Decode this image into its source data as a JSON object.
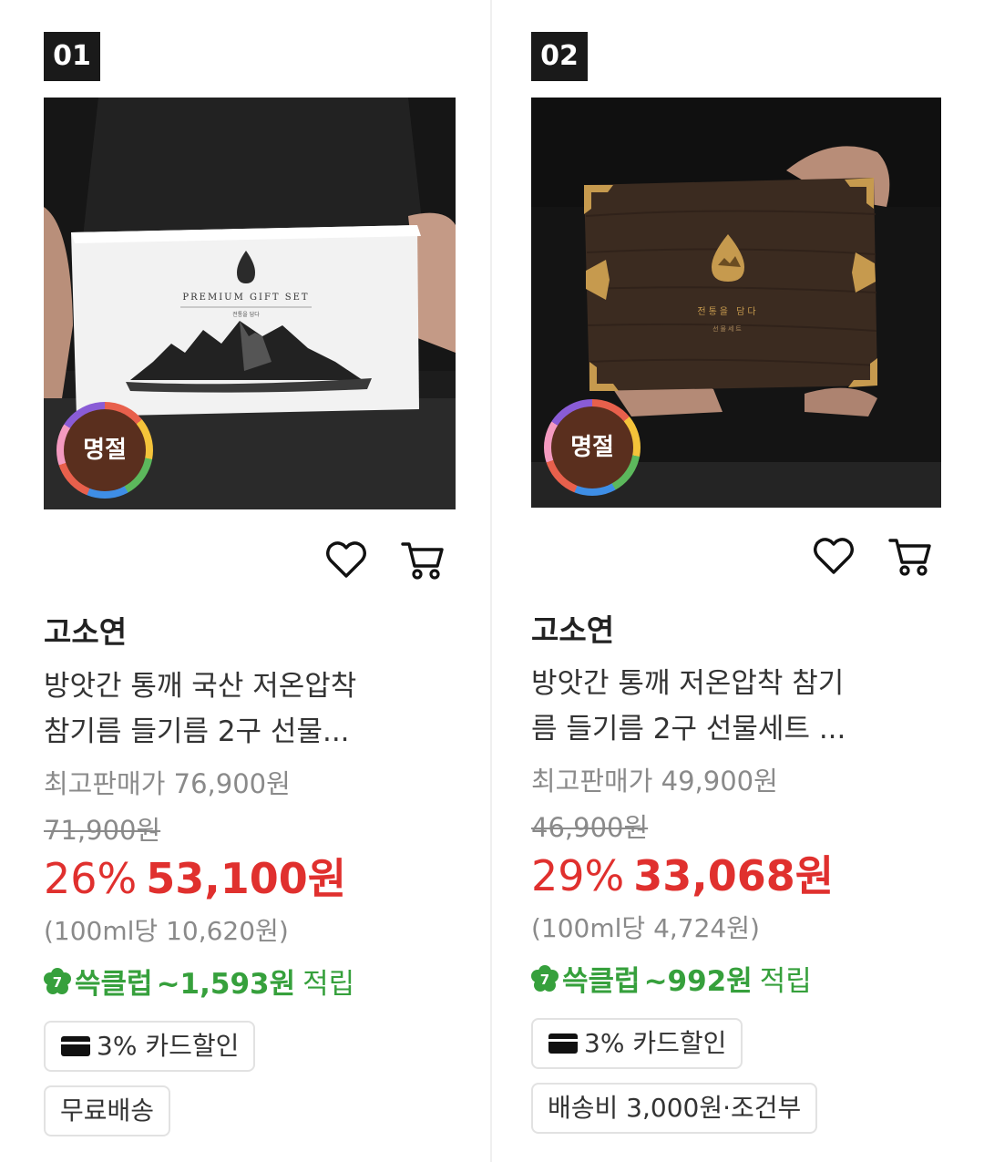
{
  "products": [
    {
      "rank": "01",
      "badge": "명절",
      "brand": "고소연",
      "title_lines": [
        "방앗간 통깨 국산 저온압착",
        "참기름 들기름 2구 선물..."
      ],
      "max_price": "최고판매가 76,900원",
      "original_price": "71,900원",
      "discount_rate": "26%",
      "sale_price": "53,100원",
      "unit_price": "(100ml당 10,620원)",
      "club_name": "쓱클럽",
      "club_amount": "~1,593원",
      "club_word": "적립",
      "card_discount": "3% 카드할인",
      "shipping": "무료배송",
      "box_text": "PREMIUM GIFT SET",
      "box_sub": "전통을 담다"
    },
    {
      "rank": "02",
      "badge": "명절",
      "brand": "고소연",
      "title_lines": [
        "방앗간 통깨 저온압착 참기",
        "름 들기름 2구 선물세트 ..."
      ],
      "max_price": "최고판매가 49,900원",
      "original_price": "46,900원",
      "discount_rate": "29%",
      "sale_price": "33,068원",
      "unit_price": "(100ml당 4,724원)",
      "club_name": "쓱클럽",
      "club_amount": "~992원",
      "club_word": "적립",
      "card_discount": "3% 카드할인",
      "shipping": "배송비 3,000원·조건부",
      "box_text": "전통을 담다",
      "box_sub": "선물세트"
    }
  ],
  "icons": {
    "wishlist": "heart-icon",
    "cart": "cart-icon",
    "club_badge": "seven-flower-icon",
    "card": "credit-card-icon"
  },
  "colors": {
    "sale_red": "#e0302e",
    "club_green": "#36a03c",
    "badge_brown": "#5a2f1e",
    "gray_text": "#8a8a8a"
  }
}
